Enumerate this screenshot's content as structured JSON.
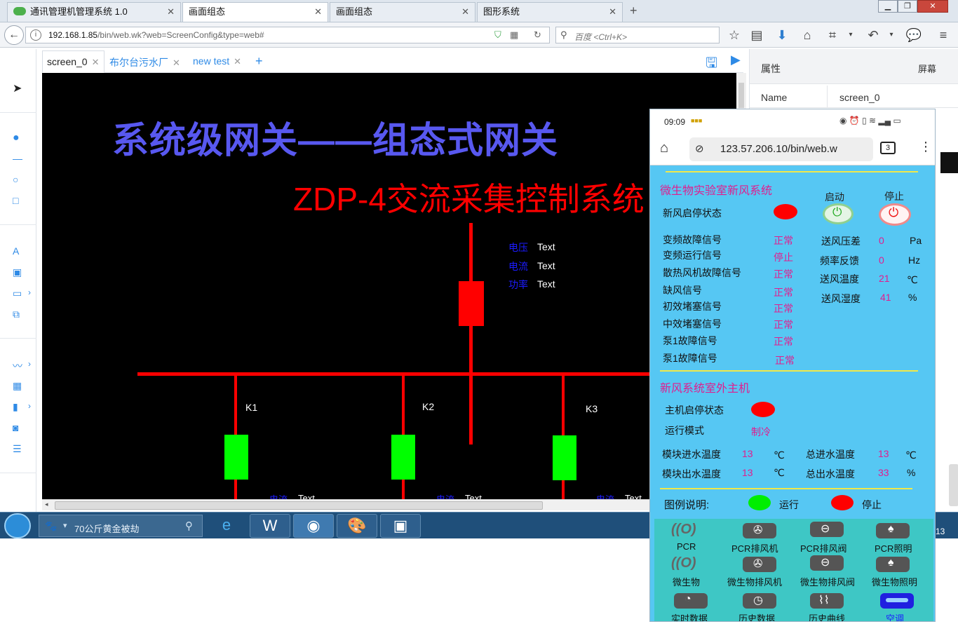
{
  "browser": {
    "tabs": [
      {
        "label": "通讯管理机管理系统 1.0"
      },
      {
        "label": "画面组态"
      },
      {
        "label": "画面组态"
      },
      {
        "label": "图形系统"
      }
    ],
    "url_host": "192.168.1.85",
    "url_path": "/bin/web.wk?web=ScreenConfig&type=web#",
    "search_placeholder": "百度 <Ctrl+K>"
  },
  "editor": {
    "tabs": [
      {
        "label": "screen_0"
      },
      {
        "label": "布尔台污水厂"
      },
      {
        "label": "new test"
      }
    ],
    "add_tab": "+"
  },
  "canvas": {
    "title": "系统级网关——组态式网关",
    "subtitle": "ZDP-4交流采集控制系统",
    "readings": [
      {
        "label": "电压",
        "value": "Text"
      },
      {
        "label": "电流",
        "value": "Text"
      },
      {
        "label": "功率",
        "value": "Text"
      }
    ],
    "branches": [
      "K1",
      "K2",
      "K3"
    ],
    "branch_readout": {
      "label": "电流",
      "value": "Text"
    },
    "colors": {
      "bus": "#ff0000",
      "breaker_main": "#ff0000",
      "breaker_branch": "#00ff00",
      "title": "#5858f0",
      "subtitle": "#ff0000"
    }
  },
  "properties": {
    "title": "属性",
    "tab": "屏幕",
    "name_key": "Name",
    "name_value": "screen_0"
  },
  "taskbar": {
    "search_text": "70公斤黄金被劫",
    "clock": "13"
  },
  "phone": {
    "time": "09:09",
    "url": "123.57.206.10/bin/web.w",
    "tab_count": "3",
    "section1_title": "微生物实验室新风系统",
    "start_label": "启动",
    "stop_label": "停止",
    "fan_state_label": "新风启停状态",
    "signals": [
      {
        "label": "变频故障信号",
        "value": "正常"
      },
      {
        "label": "变频运行信号",
        "value": "停止"
      },
      {
        "label": "散热风机故障信号",
        "value": "正常"
      },
      {
        "label": "缺风信号",
        "value": "正常"
      },
      {
        "label": "初效堵塞信号",
        "value": "正常"
      },
      {
        "label": "中效堵塞信号",
        "value": "正常"
      },
      {
        "label": "泵1故障信号",
        "value": "正常"
      },
      {
        "label": "泵1故障信号",
        "value": "正常"
      }
    ],
    "measures": [
      {
        "label": "送风压差",
        "value": "0",
        "unit": "Pa"
      },
      {
        "label": "频率反馈",
        "value": "0",
        "unit": "Hz"
      },
      {
        "label": "送风温度",
        "value": "21",
        "unit": "℃"
      },
      {
        "label": "送风湿度",
        "value": "41",
        "unit": "%"
      }
    ],
    "section2_title": "新风系统室外主机",
    "host_state_label": "主机启停状态",
    "mode_label": "运行模式",
    "mode_value": "制冷",
    "water": [
      {
        "label": "模块进水温度",
        "value": "13",
        "unit": "℃"
      },
      {
        "label": "总进水温度",
        "value": "13",
        "unit": "℃"
      },
      {
        "label": "模块出水温度",
        "value": "13",
        "unit": "℃"
      },
      {
        "label": "总出水温度",
        "value": "33",
        "unit": "%"
      }
    ],
    "legend_title": "图例说明:",
    "legend_run": "运行",
    "legend_stop": "停止",
    "nav": [
      {
        "label": "PCR"
      },
      {
        "label": "PCR排风机"
      },
      {
        "label": "PCR排风阀"
      },
      {
        "label": "PCR照明"
      },
      {
        "label": "微生物"
      },
      {
        "label": "微生物排风机"
      },
      {
        "label": "微生物排风阀"
      },
      {
        "label": "微生物照明"
      },
      {
        "label": "实时数据"
      },
      {
        "label": "历史数据"
      },
      {
        "label": "历史曲线"
      },
      {
        "label": "空调"
      }
    ],
    "colors": {
      "bg": "#56c7f3",
      "value": "#e11d8e",
      "section_title": "#e11d8e",
      "run": "#00ee00",
      "stop": "#ff0000"
    }
  }
}
